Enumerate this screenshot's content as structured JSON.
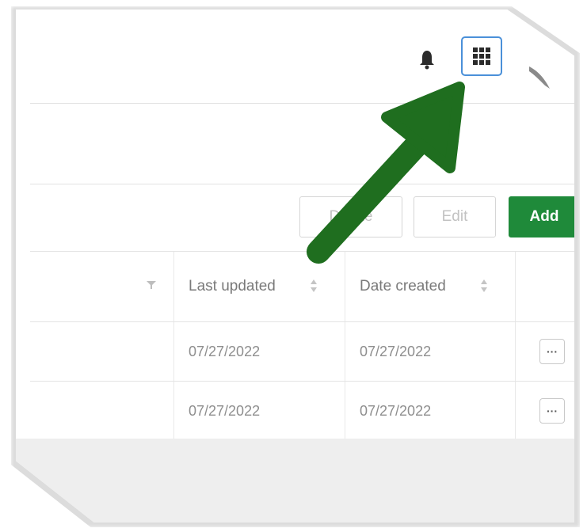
{
  "topbar": {
    "icons": [
      "bell-icon",
      "apps-grid-icon",
      "avatar"
    ]
  },
  "toolbar": {
    "delete_label": "Delete",
    "edit_label": "Edit",
    "add_label": "Add"
  },
  "table": {
    "columns": [
      "",
      "Last updated",
      "Date created",
      ""
    ],
    "rows": [
      {
        "last_updated": "07/27/2022",
        "date_created": "07/27/2022",
        "action": "···"
      },
      {
        "last_updated": "07/27/2022",
        "date_created": "07/27/2022",
        "action": "···"
      }
    ]
  },
  "colors": {
    "accent_green": "#1f8a3a",
    "arrow_green": "#1f6e1f",
    "focus_blue": "#4a90d9"
  }
}
